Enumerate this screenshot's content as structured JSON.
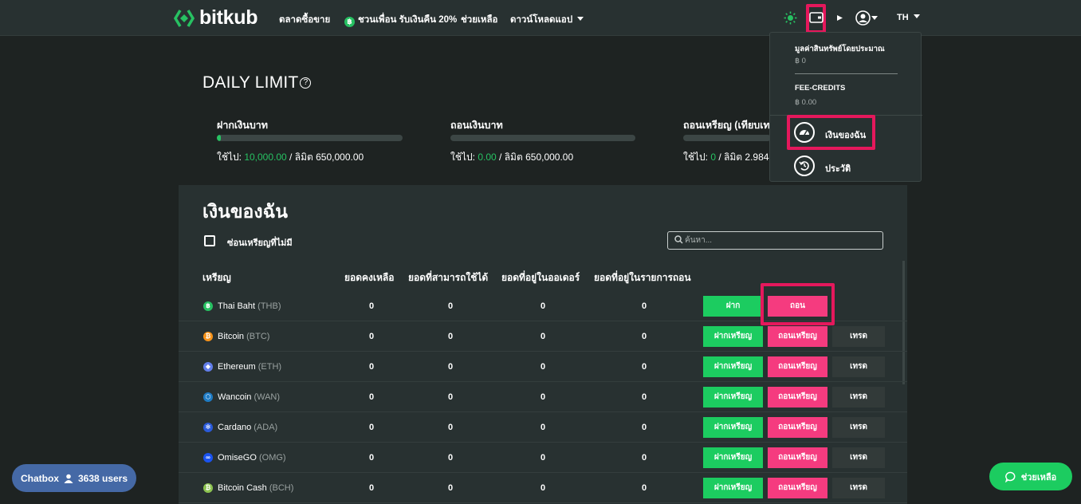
{
  "header": {
    "logo_text": "bitkub",
    "nav": {
      "market": "ตลาดซื้อขาย",
      "referral": "ชวนเพื่อน รับเงินคืน 20%",
      "help": "ช่วยเหลือ",
      "download": "ดาวน์โหลดแอป"
    },
    "language": "TH"
  },
  "wallet_dropdown": {
    "asset_value_label": "มูลค่าสินทรัพย์โดยประมาณ",
    "asset_value": "฿ 0",
    "fee_credits_label": "FEE-CREDITS",
    "fee_credits_value": "฿ 0.00",
    "my_wallet": "เงินของฉัน",
    "history": "ประวัติ"
  },
  "daily_limit": {
    "title": "DAILY LIMIT",
    "items": [
      {
        "title": "ฝากเงินบาท",
        "used_label": "ใช้ไป: ",
        "used": "10,000.00",
        "limit_label": " / ลิมิต ",
        "limit": "650,000.00",
        "fill": 0.015
      },
      {
        "title": "ถอนเงินบาท",
        "used_label": "ใช้ไป: ",
        "used": "0.00",
        "limit_label": " / ลิมิต ",
        "limit": "650,000.00",
        "fill": 0
      },
      {
        "title": "ถอนเหรียญ (เทียบเท",
        "used_label": "ใช้ไป: ",
        "used": "0",
        "limit_label": " / ลิมิต ",
        "limit": "2.9844",
        "fill": 0
      }
    ]
  },
  "wallet": {
    "title": "เงินของฉัน",
    "hide_zero_label": "ซ่อนเหรียญที่ไม่มี",
    "search_placeholder": "ค้นหา...",
    "columns": [
      "เหรียญ",
      "ยอดคงเหลือ",
      "ยอดที่สามารถใช้ได้",
      "ยอดที่อยู่ในออเดอร์",
      "ยอดที่อยู่ในรายการถอน"
    ],
    "rows": [
      {
        "name": "Thai Baht",
        "symbol": "(THB)",
        "color": "#27c162",
        "glyph": "฿",
        "balance": "0",
        "available": "0",
        "in_order": "0",
        "in_withdraw": "0",
        "deposit": "ฝาก",
        "withdraw": "ถอน",
        "trade": ""
      },
      {
        "name": "Bitcoin",
        "symbol": "(BTC)",
        "color": "#f7931a",
        "glyph": "₿",
        "balance": "0",
        "available": "0",
        "in_order": "0",
        "in_withdraw": "0",
        "deposit": "ฝากเหรียญ",
        "withdraw": "ถอนเหรียญ",
        "trade": "เทรด"
      },
      {
        "name": "Ethereum",
        "symbol": "(ETH)",
        "color": "#627eea",
        "glyph": "◆",
        "balance": "0",
        "available": "0",
        "in_order": "0",
        "in_withdraw": "0",
        "deposit": "ฝากเหรียญ",
        "withdraw": "ถอนเหรียญ",
        "trade": "เทรด"
      },
      {
        "name": "Wancoin",
        "symbol": "(WAN)",
        "color": "#1e7bc4",
        "glyph": "⬡",
        "balance": "0",
        "available": "0",
        "in_order": "0",
        "in_withdraw": "0",
        "deposit": "ฝากเหรียญ",
        "withdraw": "ถอนเหรียญ",
        "trade": "เทรด"
      },
      {
        "name": "Cardano",
        "symbol": "(ADA)",
        "color": "#2a5ada",
        "glyph": "✻",
        "balance": "0",
        "available": "0",
        "in_order": "0",
        "in_withdraw": "0",
        "deposit": "ฝากเหรียญ",
        "withdraw": "ถอนเหรียญ",
        "trade": "เทรด"
      },
      {
        "name": "OmiseGO",
        "symbol": "(OMG)",
        "color": "#1a53f0",
        "glyph": "∞",
        "balance": "0",
        "available": "0",
        "in_order": "0",
        "in_withdraw": "0",
        "deposit": "ฝากเหรียญ",
        "withdraw": "ถอนเหรียญ",
        "trade": "เทรด"
      },
      {
        "name": "Bitcoin Cash",
        "symbol": "(BCH)",
        "color": "#8dc351",
        "glyph": "₿",
        "balance": "0",
        "available": "0",
        "in_order": "0",
        "in_withdraw": "0",
        "deposit": "ฝากเหรียญ",
        "withdraw": "ถอนเหรียญ",
        "trade": "เทรด"
      }
    ]
  },
  "chatbox": {
    "label": "Chatbox",
    "users": "3638 users"
  },
  "help_button": "ช่วยเหลือ",
  "colors": {
    "brand_green": "#27c162",
    "withdraw_pink": "#f53b7f",
    "highlight": "#e5185c"
  }
}
